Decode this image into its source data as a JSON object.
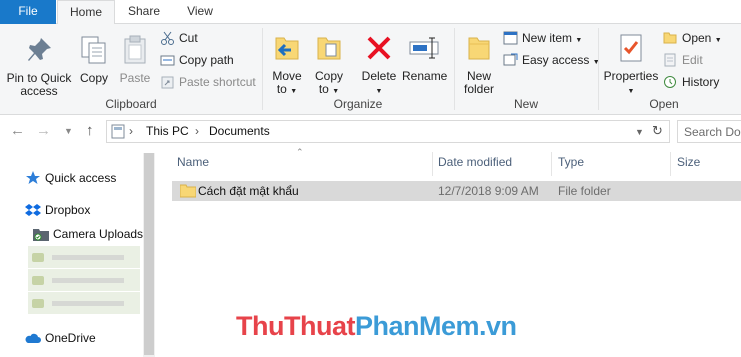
{
  "tabs": {
    "file": "File",
    "home": "Home",
    "share": "Share",
    "view": "View"
  },
  "clipboard": {
    "pin": "Pin to Quick access",
    "copy": "Copy",
    "paste": "Paste",
    "cut": "Cut",
    "copy_path": "Copy path",
    "paste_shortcut": "Paste shortcut",
    "label": "Clipboard"
  },
  "organize": {
    "move_to": "Move to",
    "copy_to": "Copy to",
    "delete": "Delete",
    "rename": "Rename",
    "label": "Organize"
  },
  "new": {
    "new_folder": "New folder",
    "new_item": "New item",
    "easy_access": "Easy access",
    "label": "New"
  },
  "open": {
    "properties": "Properties",
    "open": "Open",
    "edit": "Edit",
    "history": "History",
    "label": "Open"
  },
  "address": {
    "crumbs": [
      "This PC",
      "Documents"
    ],
    "search_placeholder": "Search Do"
  },
  "nav_pane": {
    "quick_access": "Quick access",
    "dropbox": "Dropbox",
    "camera_uploads": "Camera Uploads",
    "onedrive": "OneDrive"
  },
  "columns": {
    "name": "Name",
    "date_modified": "Date modified",
    "type": "Type",
    "size": "Size"
  },
  "files": [
    {
      "name": "Cách đặt mật khẩu",
      "date_modified": "12/7/2018 9:09 AM",
      "type": "File folder",
      "size": ""
    }
  ],
  "watermark": {
    "part1": "ThuThuat",
    "part2": "PhanMem",
    "part3": ".vn"
  },
  "colors": {
    "file_tab": "#1979ca",
    "selected_row": "#d9d9d9",
    "folder": "#f8d775",
    "delete_red": "#e81123"
  }
}
